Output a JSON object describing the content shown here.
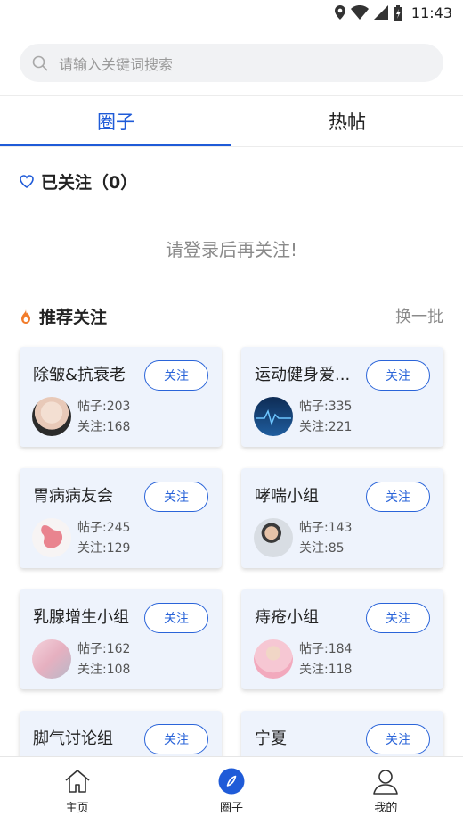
{
  "status_bar": {
    "time": "11:43"
  },
  "search": {
    "placeholder": "请输入关键词搜索"
  },
  "tabs": [
    {
      "label": "圈子",
      "active": true
    },
    {
      "label": "热帖",
      "active": false
    }
  ],
  "followed": {
    "title": "已关注（0）",
    "empty_message": "请登录后再关注!"
  },
  "recommended": {
    "title": "推荐关注",
    "refresh_label": "换一批",
    "groups": [
      {
        "name": "除皱&抗衰老",
        "posts": "帖子:203",
        "follows": "关注:168",
        "follow_label": "关注"
      },
      {
        "name": "运动健身爱...",
        "posts": "帖子:335",
        "follows": "关注:221",
        "follow_label": "关注"
      },
      {
        "name": "胃病病友会",
        "posts": "帖子:245",
        "follows": "关注:129",
        "follow_label": "关注"
      },
      {
        "name": "哮喘小组",
        "posts": "帖子:143",
        "follows": "关注:85",
        "follow_label": "关注"
      },
      {
        "name": "乳腺增生小组",
        "posts": "帖子:162",
        "follows": "关注:108",
        "follow_label": "关注"
      },
      {
        "name": "痔疮小组",
        "posts": "帖子:184",
        "follows": "关注:118",
        "follow_label": "关注"
      },
      {
        "name": "脚气讨论组",
        "follow_label": "关注"
      },
      {
        "name": "宁夏",
        "follow_label": "关注"
      }
    ]
  },
  "bottom_nav": [
    {
      "label": "主页",
      "icon": "home-icon"
    },
    {
      "label": "圈子",
      "icon": "compass-icon",
      "active": true
    },
    {
      "label": "我的",
      "icon": "user-icon"
    }
  ],
  "colors": {
    "accent": "#1f5bd8",
    "card_bg": "#eef3fc",
    "muted": "#8a8a8a"
  }
}
